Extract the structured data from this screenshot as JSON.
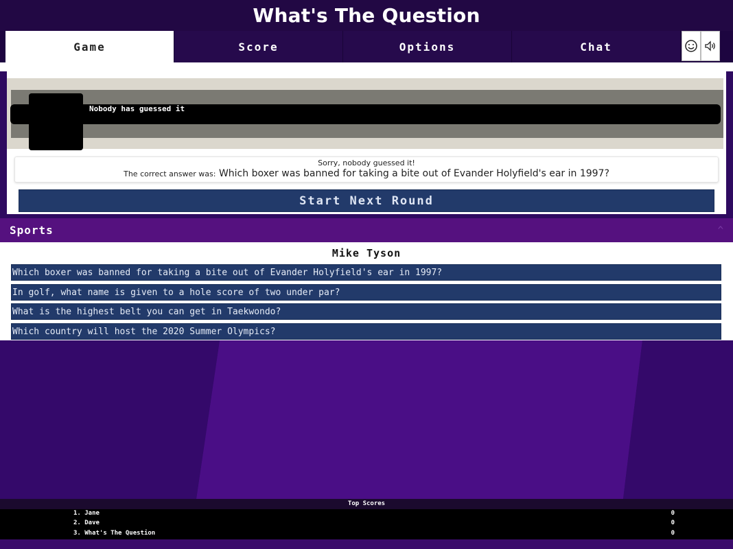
{
  "app": {
    "title": "What's The Question"
  },
  "tabs": [
    {
      "label": "Game",
      "active": true
    },
    {
      "label": "Score",
      "active": false
    },
    {
      "label": "Options",
      "active": false
    },
    {
      "label": "Chat",
      "active": false
    }
  ],
  "toolbar": {
    "icons": [
      "smiley-icon",
      "speaker-icon"
    ]
  },
  "round": {
    "guess_status": "Nobody has guessed it",
    "sorry_text": "Sorry, nobody guessed it!",
    "answer_prefix": "The correct answer was:",
    "answer_text": "Which boxer was banned for taking a bite out of Evander Holyfield's ear in 1997?",
    "start_button": "Start Next Round"
  },
  "category": {
    "name": "Sports",
    "caret": "^"
  },
  "subject": "Mike Tyson",
  "questions": [
    "Which boxer was banned for taking a bite out of Evander Holyfield's ear in 1997?",
    "In golf, what name is given to a hole score of two under par?",
    "What is the highest belt you can get in Taekwondo?",
    "Which country will host the 2020 Summer Olympics?"
  ],
  "top_scores": {
    "title": "Top Scores",
    "rows": [
      {
        "name": "1. Jane",
        "score": "0"
      },
      {
        "name": "2. Dave",
        "score": "0"
      },
      {
        "name": "3. What's The Question",
        "score": "0"
      }
    ]
  },
  "colors": {
    "background": "#2b0a5a",
    "accent_purple": "#55117f",
    "button_blue": "#223a6a"
  }
}
